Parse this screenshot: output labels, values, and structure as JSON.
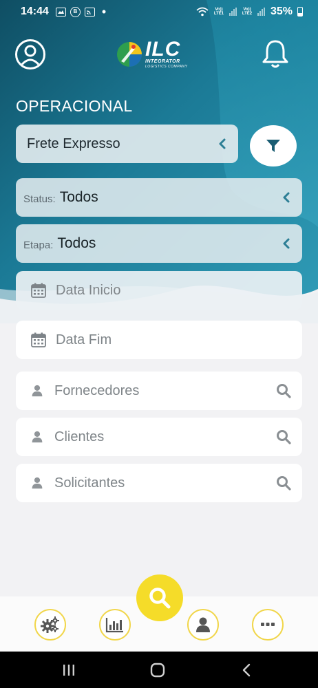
{
  "status_bar": {
    "time": "14:44",
    "notification_icons": [
      "image-icon",
      "b-icon",
      "cast-icon"
    ],
    "sim1_label": "Vo)) LTE1",
    "sim2_label": "Vo)) LTE2",
    "battery_percent": "35%",
    "battery_level": 0.35
  },
  "header": {
    "logo_main": "ILC",
    "logo_line1": "INTEGRATOR",
    "logo_line2": "LOGISTICS COMPANY"
  },
  "section_title": "OPERACIONAL",
  "service_select": {
    "value": "Frete Expresso"
  },
  "status_select": {
    "label": "Status:",
    "value": "Todos"
  },
  "etapa_select": {
    "label": "Etapa:",
    "value": "Todos"
  },
  "date_start": {
    "placeholder": "Data Inicio"
  },
  "date_end": {
    "placeholder": "Data Fim"
  },
  "suppliers": {
    "placeholder": "Fornecedores"
  },
  "clients": {
    "placeholder": "Clientes"
  },
  "requesters": {
    "placeholder": "Solicitantes"
  },
  "colors": {
    "header_teal": "#1b7a96",
    "header_teal_dark": "#12556b",
    "accent_yellow": "#f5dc29",
    "icon_dark": "#1a5d73",
    "field_glass": "#e1eaee"
  },
  "bottom_nav": [
    "settings-gears-icon",
    "bar-chart-icon",
    "user-icon",
    "more-dots-icon"
  ]
}
